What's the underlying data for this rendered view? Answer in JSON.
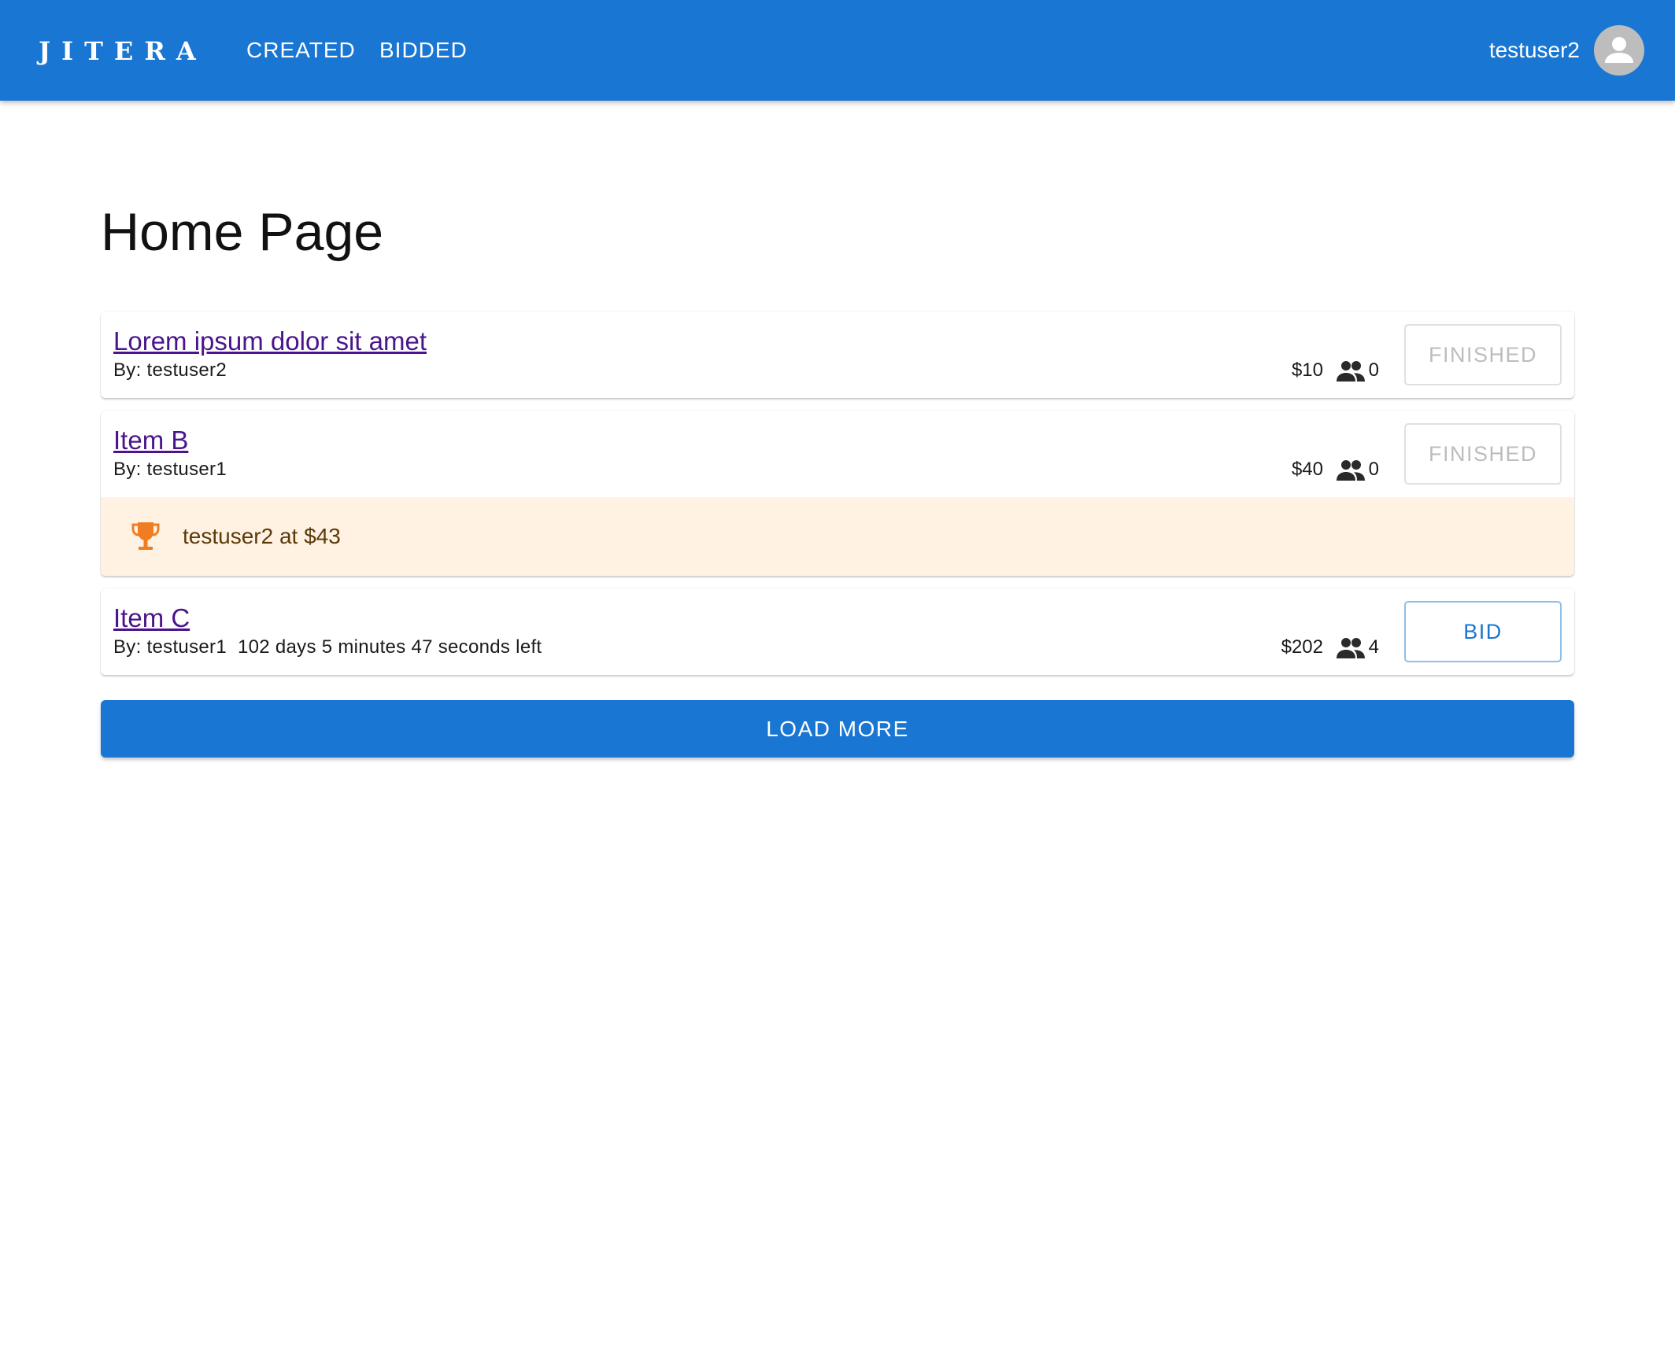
{
  "appbar": {
    "logo": "JITERA",
    "nav": [
      {
        "label": "CREATED"
      },
      {
        "label": "BIDDED"
      }
    ],
    "username": "testuser2"
  },
  "page": {
    "title": "Home Page"
  },
  "items": [
    {
      "title": "Lorem ipsum dolor sit amet",
      "by": "By: testuser2",
      "time_left": "",
      "price": "$10",
      "bids": "0",
      "action_label": "FINISHED",
      "action_state": "disabled"
    },
    {
      "title": "Item B",
      "by": "By: testuser1",
      "time_left": "",
      "price": "$40",
      "bids": "0",
      "action_label": "FINISHED",
      "action_state": "disabled",
      "winner": "testuser2 at $43"
    },
    {
      "title": "Item C",
      "by": "By: testuser1",
      "time_left": "102 days 5 minutes 47 seconds left",
      "price": "$202",
      "bids": "4",
      "action_label": "BID",
      "action_state": "enabled"
    }
  ],
  "load_more_label": "LOAD MORE",
  "icons": {
    "avatar": "account-circle-icon",
    "bidders": "people-icon",
    "winner": "trophy-icon"
  },
  "colors": {
    "primary": "#1976d2",
    "link": "#4a148c",
    "winner_bg": "#fff2e3",
    "trophy": "#ef7d22"
  }
}
